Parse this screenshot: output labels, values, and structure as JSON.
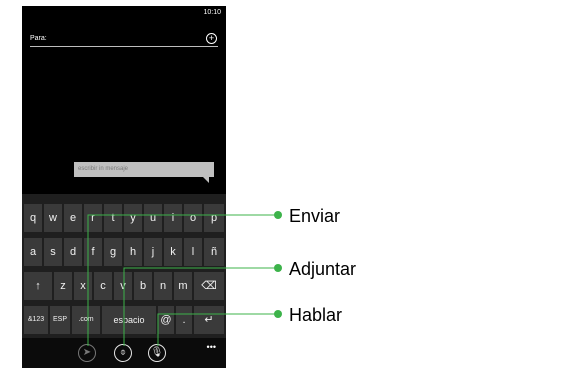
{
  "status_bar": {
    "time": "10:10"
  },
  "compose": {
    "to_label": "Para:",
    "add_icon": "plus-circle-icon",
    "message_placeholder": "escribir in mensaje"
  },
  "keyboard": {
    "row1": [
      "q",
      "w",
      "e",
      "r",
      "t",
      "y",
      "u",
      "i",
      "o",
      "p"
    ],
    "row2": [
      "a",
      "s",
      "d",
      "f",
      "g",
      "h",
      "j",
      "k",
      "l",
      "ñ"
    ],
    "row3": [
      "↑",
      "z",
      "x",
      "c",
      "v",
      "b",
      "n",
      "m",
      "⌫"
    ],
    "row4": [
      "&123",
      "ESP",
      ".com",
      "espacio",
      "@",
      ".",
      "↵"
    ]
  },
  "app_bar": {
    "send_icon": "send-icon",
    "attach_icon": "paperclip-icon",
    "speak_icon": "microphone-icon",
    "more": "•••"
  },
  "callouts": {
    "send": "Enviar",
    "attach": "Adjuntar",
    "speak": "Hablar",
    "color": "#3cb34a"
  }
}
